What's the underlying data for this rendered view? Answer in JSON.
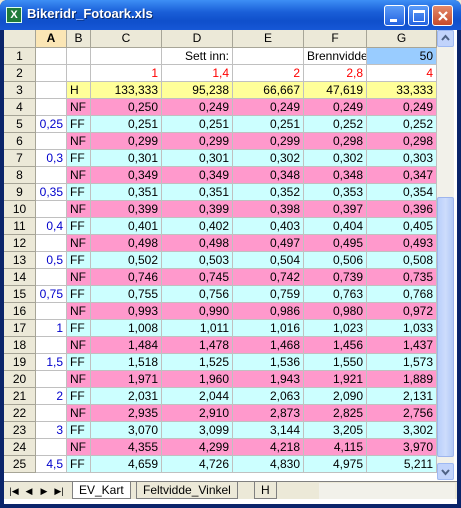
{
  "window": {
    "title": "Bikeridr_Fotoark.xls"
  },
  "columns": [
    "A",
    "B",
    "C",
    "D",
    "E",
    "F",
    "G"
  ],
  "row1": {
    "sett_inn": "Sett inn:",
    "brennvidde": "Brennvidde:",
    "value": "50"
  },
  "row2": [
    "1",
    "1,4",
    "2",
    "2,8",
    "4"
  ],
  "row3": {
    "label": "H",
    "values": [
      "133,333",
      "95,238",
      "66,667",
      "47,619",
      "33,333"
    ]
  },
  "rows": [
    {
      "num": "4",
      "a": "",
      "b": "NF",
      "vals": [
        "0,250",
        "0,249",
        "0,249",
        "0,249",
        "0,249"
      ]
    },
    {
      "num": "5",
      "a": "0,25",
      "b": "FF",
      "vals": [
        "0,251",
        "0,251",
        "0,251",
        "0,252",
        "0,252"
      ]
    },
    {
      "num": "6",
      "a": "",
      "b": "NF",
      "vals": [
        "0,299",
        "0,299",
        "0,299",
        "0,298",
        "0,298"
      ]
    },
    {
      "num": "7",
      "a": "0,3",
      "b": "FF",
      "vals": [
        "0,301",
        "0,301",
        "0,302",
        "0,302",
        "0,303"
      ]
    },
    {
      "num": "8",
      "a": "",
      "b": "NF",
      "vals": [
        "0,349",
        "0,349",
        "0,348",
        "0,348",
        "0,347"
      ]
    },
    {
      "num": "9",
      "a": "0,35",
      "b": "FF",
      "vals": [
        "0,351",
        "0,351",
        "0,352",
        "0,353",
        "0,354"
      ]
    },
    {
      "num": "10",
      "a": "",
      "b": "NF",
      "vals": [
        "0,399",
        "0,399",
        "0,398",
        "0,397",
        "0,396"
      ]
    },
    {
      "num": "11",
      "a": "0,4",
      "b": "FF",
      "vals": [
        "0,401",
        "0,402",
        "0,403",
        "0,404",
        "0,405"
      ]
    },
    {
      "num": "12",
      "a": "",
      "b": "NF",
      "vals": [
        "0,498",
        "0,498",
        "0,497",
        "0,495",
        "0,493"
      ]
    },
    {
      "num": "13",
      "a": "0,5",
      "b": "FF",
      "vals": [
        "0,502",
        "0,503",
        "0,504",
        "0,506",
        "0,508"
      ]
    },
    {
      "num": "14",
      "a": "",
      "b": "NF",
      "vals": [
        "0,746",
        "0,745",
        "0,742",
        "0,739",
        "0,735"
      ]
    },
    {
      "num": "15",
      "a": "0,75",
      "b": "FF",
      "vals": [
        "0,755",
        "0,756",
        "0,759",
        "0,763",
        "0,768"
      ]
    },
    {
      "num": "16",
      "a": "",
      "b": "NF",
      "vals": [
        "0,993",
        "0,990",
        "0,986",
        "0,980",
        "0,972"
      ]
    },
    {
      "num": "17",
      "a": "1",
      "b": "FF",
      "vals": [
        "1,008",
        "1,011",
        "1,016",
        "1,023",
        "1,033"
      ]
    },
    {
      "num": "18",
      "a": "",
      "b": "NF",
      "vals": [
        "1,484",
        "1,478",
        "1,468",
        "1,456",
        "1,437"
      ]
    },
    {
      "num": "19",
      "a": "1,5",
      "b": "FF",
      "vals": [
        "1,518",
        "1,525",
        "1,536",
        "1,550",
        "1,573"
      ]
    },
    {
      "num": "20",
      "a": "",
      "b": "NF",
      "vals": [
        "1,971",
        "1,960",
        "1,943",
        "1,921",
        "1,889"
      ]
    },
    {
      "num": "21",
      "a": "2",
      "b": "FF",
      "vals": [
        "2,031",
        "2,044",
        "2,063",
        "2,090",
        "2,131"
      ]
    },
    {
      "num": "22",
      "a": "",
      "b": "NF",
      "vals": [
        "2,935",
        "2,910",
        "2,873",
        "2,825",
        "2,756"
      ]
    },
    {
      "num": "23",
      "a": "3",
      "b": "FF",
      "vals": [
        "3,070",
        "3,099",
        "3,144",
        "3,205",
        "3,302"
      ]
    },
    {
      "num": "24",
      "a": "",
      "b": "NF",
      "vals": [
        "4,355",
        "4,299",
        "4,218",
        "4,115",
        "3,970"
      ]
    },
    {
      "num": "25",
      "a": "4,5",
      "b": "FF",
      "vals": [
        "4,659",
        "4,726",
        "4,830",
        "4,975",
        "5,211"
      ]
    }
  ],
  "tabs": [
    "EV_Kart",
    "Feltvidde_Vinkel",
    "H"
  ],
  "colors": {
    "nf": "#ff99cc",
    "ff": "#ccffff",
    "h": "#ffff99",
    "brennvidde_value": "#99ccff"
  }
}
